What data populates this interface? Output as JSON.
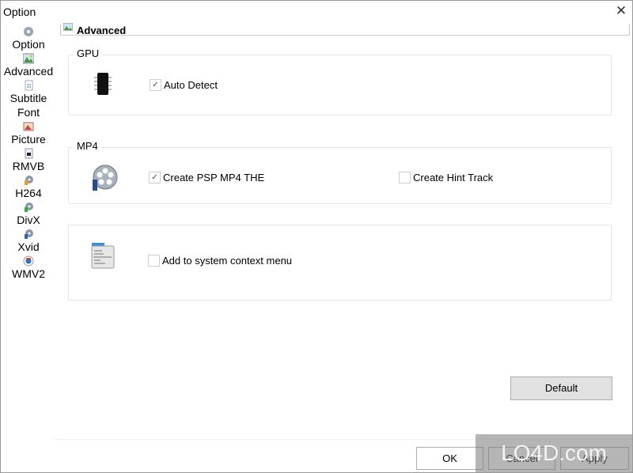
{
  "window": {
    "title": "Option",
    "close_icon": "close-icon"
  },
  "sidebar": {
    "items": [
      {
        "label": "Option",
        "icon": "gear-cd-icon"
      },
      {
        "label": "Advanced",
        "icon": "advanced-image-icon"
      },
      {
        "label": "Subtitle",
        "icon": "subtitle-document-icon"
      },
      {
        "label": "Font",
        "icon": ""
      },
      {
        "label": "Picture",
        "icon": "picture-icon"
      },
      {
        "label": "RMVB",
        "icon": "rmvb-file-icon"
      },
      {
        "label": "H264",
        "icon": "h264-reel-icon"
      },
      {
        "label": "DivX",
        "icon": "divx-reel-icon"
      },
      {
        "label": "Xvid",
        "icon": "xvid-reel-icon"
      },
      {
        "label": "WMV2",
        "icon": "wmv-icon"
      }
    ]
  },
  "header": {
    "title": "Advanced"
  },
  "groups": {
    "gpu": {
      "legend": "GPU",
      "auto_detect": {
        "label": "Auto Detect",
        "checked": true
      }
    },
    "mp4": {
      "legend": "MP4",
      "psp": {
        "label": "Create PSP MP4 THE",
        "checked": true
      },
      "hint": {
        "label": "Create Hint Track",
        "checked": false
      }
    },
    "context": {
      "add_context": {
        "label": "Add to system context menu",
        "checked": false
      }
    }
  },
  "buttons": {
    "default": "Default",
    "ok": "OK",
    "cancel": "Cancel",
    "apply": "Apply"
  },
  "watermark": "LO4D.com"
}
